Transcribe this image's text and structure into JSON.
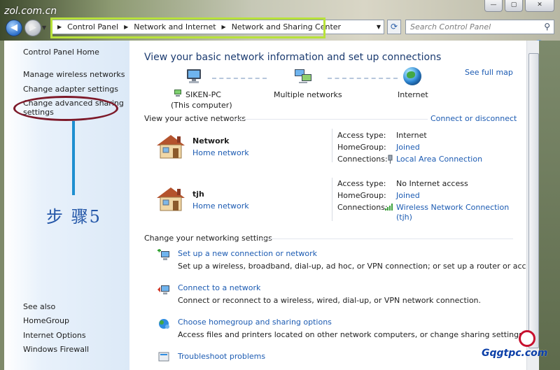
{
  "watermark_top": "zol.com.cn",
  "window_controls": {
    "minimize": "—",
    "maximize": "▢",
    "close": "✕"
  },
  "nav": {
    "back_icon": "back-arrow-icon",
    "forward_icon": "forward-arrow-icon",
    "breadcrumbs": [
      "Control Panel",
      "Network and Internet",
      "Network and Sharing Center"
    ],
    "search_placeholder": "Search Control Panel"
  },
  "sidebar": {
    "home": "Control Panel Home",
    "links": [
      "Manage wireless networks",
      "Change adapter settings",
      "Change advanced sharing",
      "settings"
    ],
    "see_also_label": "See also",
    "see_also": [
      "HomeGroup",
      "Internet Options",
      "Windows Firewall"
    ]
  },
  "annotation": {
    "step_text": "步 骤5"
  },
  "main": {
    "title": "View your basic network information and set up connections",
    "see_full_map": "See full map",
    "map": {
      "computer_name": "SIKEN-PC",
      "computer_sub": "(This computer)",
      "middle": "Multiple networks",
      "internet": "Internet"
    },
    "active_header": "View your active networks",
    "connect_disconnect": "Connect or disconnect",
    "networks": [
      {
        "name": "Network",
        "type": "Home network",
        "access_label": "Access type:",
        "access": "Internet",
        "homegroup_label": "HomeGroup:",
        "homegroup": "Joined",
        "connections_label": "Connections:",
        "connection": "Local Area Connection",
        "connection2": ""
      },
      {
        "name": "tjh",
        "type": "Home network",
        "access_label": "Access type:",
        "access": "No Internet access",
        "homegroup_label": "HomeGroup:",
        "homegroup": "Joined",
        "connections_label": "Connections:",
        "connection": "Wireless Network Connection",
        "connection2": "(tjh)"
      }
    ],
    "settings_header": "Change your networking settings",
    "tasks": [
      {
        "title": "Set up a new connection or network",
        "desc": "Set up a wireless, broadband, dial-up, ad hoc, or VPN connection; or set up a router or access point."
      },
      {
        "title": "Connect to a network",
        "desc": "Connect or reconnect to a wireless, wired, dial-up, or VPN network connection."
      },
      {
        "title": "Choose homegroup and sharing options",
        "desc": "Access files and printers located on other network computers, or change sharing settings."
      },
      {
        "title": "Troubleshoot problems",
        "desc": ""
      }
    ]
  },
  "watermark_bottom": "Gqgtpc.com"
}
